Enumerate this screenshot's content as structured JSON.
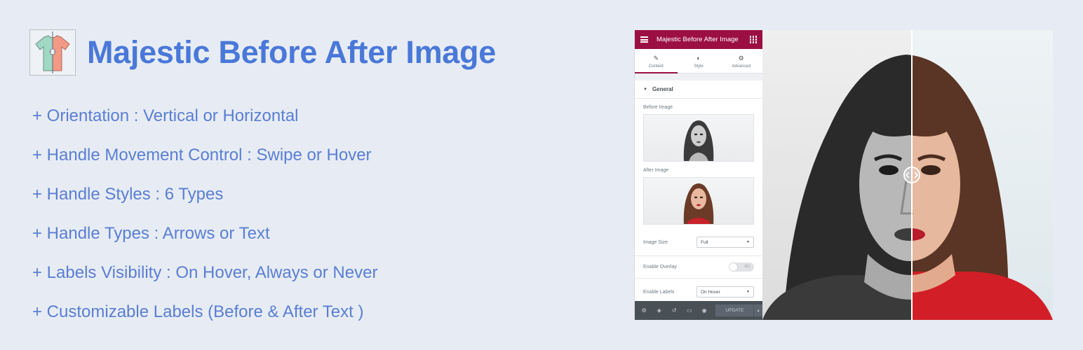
{
  "page": {
    "title": "Majestic Before After Image",
    "logo_icon": "tshirt-split-icon",
    "accent_color": "#4a78d9",
    "text_color": "#5a7ed3",
    "features": [
      "+ Orientation : Vertical or Horizontal",
      "+ Handle Movement Control : Swipe or Hover",
      "+ Handle Styles : 6 Types",
      "+ Handle Types : Arrows or Text",
      "+ Labels Visibility : On Hover, Always or Never",
      "+ Customizable Labels (Before & After Text )"
    ]
  },
  "editor": {
    "header_title": "Majestic Before After Image",
    "header_color": "#9c0f43",
    "tabs": [
      {
        "label": "Content",
        "icon": "pencil-icon",
        "active": true
      },
      {
        "label": "Style",
        "icon": "half-circle-icon",
        "active": false
      },
      {
        "label": "Advanced",
        "icon": "gear-icon",
        "active": false
      }
    ],
    "section_title": "General",
    "before_image_label": "Before Image",
    "after_image_label": "After Image",
    "image_size_label": "Image Size",
    "image_size_value": "Full",
    "enable_overlay_label": "Enable Overlay",
    "enable_overlay_state": "NO",
    "enable_labels_label": "Enable Labels",
    "enable_labels_value": "On Hover",
    "footer_icons": [
      "gear-icon",
      "layers-icon",
      "history-icon",
      "responsive-icon",
      "eye-icon"
    ],
    "update_label": "UPDATE"
  },
  "preview": {
    "divider_position": 0.515,
    "handle_icon": "left-right-arrows-icon"
  }
}
